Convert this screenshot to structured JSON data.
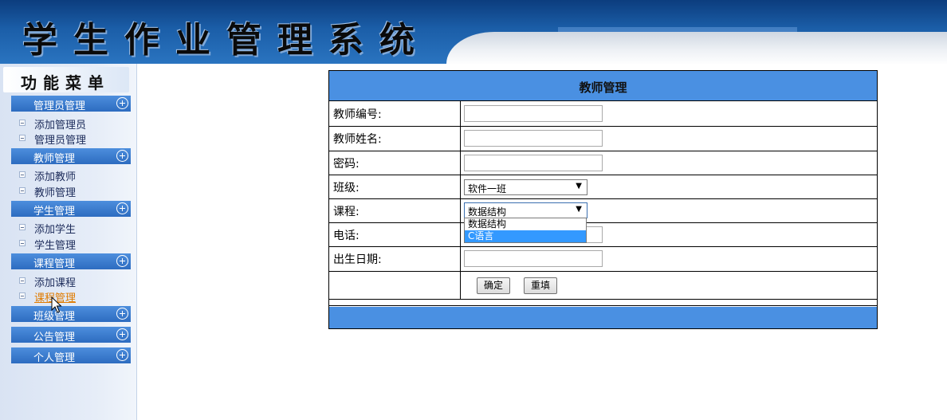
{
  "header": {
    "title": "学生作业管理系统"
  },
  "sidebar": {
    "menu_title": "功能菜单",
    "groups": [
      {
        "label": "管理员管理",
        "items": [
          "添加管理员",
          "管理员管理"
        ]
      },
      {
        "label": "教师管理",
        "items": [
          "添加教师",
          "教师管理"
        ]
      },
      {
        "label": "学生管理",
        "items": [
          "添加学生",
          "学生管理"
        ]
      },
      {
        "label": "课程管理",
        "items": [
          "添加课程",
          "课程管理"
        ]
      },
      {
        "label": "班级管理",
        "items": []
      },
      {
        "label": "公告管理",
        "items": []
      },
      {
        "label": "个人管理",
        "items": []
      }
    ],
    "active_item": "课程管理"
  },
  "form": {
    "title": "教师管理",
    "fields": {
      "teacher_id": {
        "label": "教师编号:",
        "value": ""
      },
      "teacher_name": {
        "label": "教师姓名:",
        "value": ""
      },
      "password": {
        "label": "密码:",
        "value": ""
      },
      "class": {
        "label": "班级:",
        "selected": "软件一班"
      },
      "course": {
        "label": "课程:",
        "selected": "数据结构",
        "options": [
          "数据结构",
          "C语言"
        ],
        "highlighted": "C语言"
      },
      "phone": {
        "label": "电话:",
        "value": ""
      },
      "birthday": {
        "label": "出生日期:",
        "value": ""
      }
    },
    "buttons": {
      "submit": "确定",
      "reset": "重填"
    }
  },
  "colors": {
    "accent": "#4a90e2",
    "header_dark": "#0c3d7e",
    "active_link": "#e07b00",
    "dropdown_highlight": "#3399ff"
  }
}
